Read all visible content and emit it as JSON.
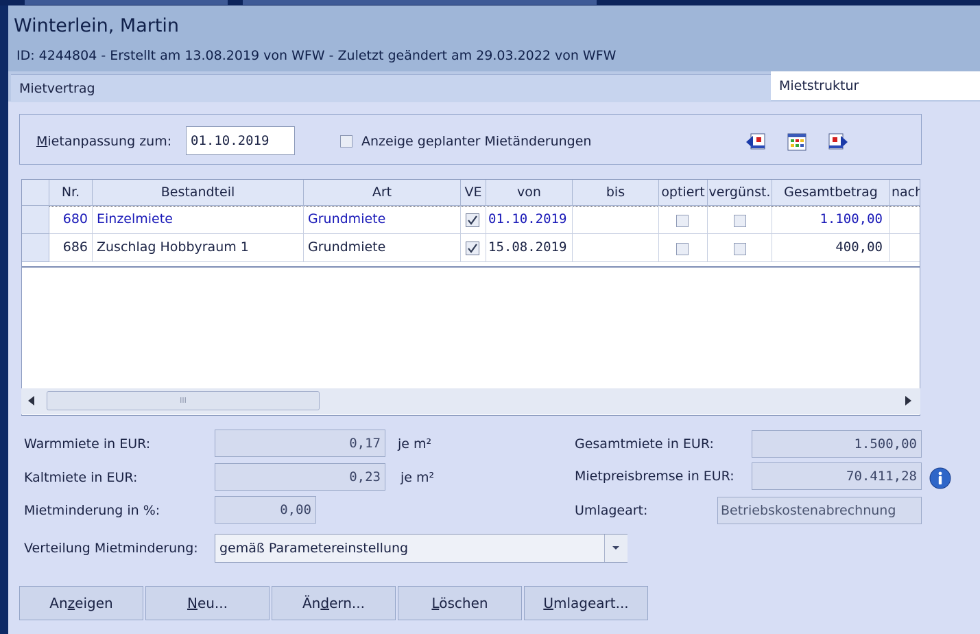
{
  "window": {
    "title": "Winterlein, Martin",
    "subtitle": "ID: 4244804 - Erstellt am 13.08.2019 von WFW - Zuletzt geändert am 29.03.2022 von WFW"
  },
  "tabs": [
    {
      "label": "Mietvertrag",
      "active": false
    },
    {
      "label": "Mietstruktur",
      "active": true
    }
  ],
  "filter": {
    "date_label_prefix": "M",
    "date_label_rest": "ietanpassung zum:",
    "date_value": "01.10.2019",
    "planned_checkbox_label": "Anzeige geplanter Mietänderungen",
    "planned_checked": false
  },
  "toolbar_icons": [
    "previous-record-icon",
    "grid-view-icon",
    "next-record-icon"
  ],
  "grid": {
    "columns": [
      "Nr.",
      "Bestandteil",
      "Art",
      "VE",
      "von",
      "bis",
      "optiert",
      "vergünst.",
      "Gesamtbetrag",
      "nach"
    ],
    "rows": [
      {
        "nr": "680",
        "bestandteil": "Einzelmiete",
        "art": "Grundmiete",
        "ve": true,
        "von": "01.10.2019",
        "bis": "",
        "optiert": false,
        "verguenst": false,
        "gesamtbetrag": "1.100,00",
        "selected": true
      },
      {
        "nr": "686",
        "bestandteil": "Zuschlag Hobbyraum 1",
        "art": "Grundmiete",
        "ve": true,
        "von": "15.08.2019",
        "bis": "",
        "optiert": false,
        "verguenst": false,
        "gesamtbetrag": "400,00",
        "selected": false
      }
    ],
    "scroll_grip": "III"
  },
  "summary": {
    "warmmiete_label": "Warmmiete in EUR:",
    "warmmiete_value": "0,17",
    "kaltmiete_label": "Kaltmiete in EUR:",
    "kaltmiete_value": "0,23",
    "per_sqm": "je m²",
    "mietminderung_label": "Mietminderung in %:",
    "mietminderung_value": "0,00",
    "verteilung_label": "Verteilung Mietminderung:",
    "verteilung_value": "gemäß Parametereinstellung",
    "gesamtmiete_label": "Gesamtmiete in EUR:",
    "gesamtmiete_value": "1.500,00",
    "mietpreisbremse_label": "Mietpreisbremse in EUR:",
    "mietpreisbremse_value": "70.411,28",
    "umlageart_label": "Umlageart:",
    "umlageart_value": "Betriebskostenabrechnung"
  },
  "buttons": [
    {
      "pre": "An",
      "key": "z",
      "post": "eigen"
    },
    {
      "pre": "",
      "key": "N",
      "post": "eu..."
    },
    {
      "pre": "Än",
      "key": "d",
      "post": "ern..."
    },
    {
      "pre": "",
      "key": "L",
      "post": "öschen"
    },
    {
      "pre": "",
      "key": "U",
      "post": "mlageart..."
    }
  ]
}
